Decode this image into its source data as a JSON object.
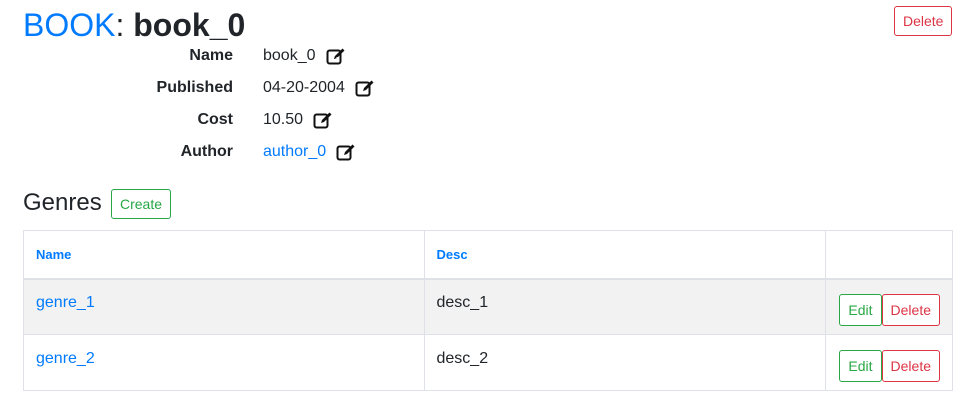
{
  "header": {
    "entity": "BOOK",
    "separator": ":",
    "record": "book_0",
    "delete_label": "Delete"
  },
  "fields": [
    {
      "label": "Name",
      "value": "book_0"
    },
    {
      "label": "Published",
      "value": "04-20-2004"
    },
    {
      "label": "Cost",
      "value": "10.50"
    },
    {
      "label": "Author",
      "value": "author_0"
    }
  ],
  "genres": {
    "title": "Genres",
    "create_label": "Create",
    "columns": [
      "Name",
      "Desc",
      ""
    ],
    "rows": [
      {
        "name": "genre_1",
        "desc": "desc_1",
        "edit": "Edit",
        "delete": "Delete"
      },
      {
        "name": "genre_2",
        "desc": "desc_2",
        "edit": "Edit",
        "delete": "Delete"
      }
    ]
  },
  "colors": {
    "link": "#007bff",
    "danger": "#dc3545",
    "success": "#28a745",
    "stripe": "#f2f2f2"
  },
  "icons": {
    "edit": "pencil-square-icon"
  }
}
